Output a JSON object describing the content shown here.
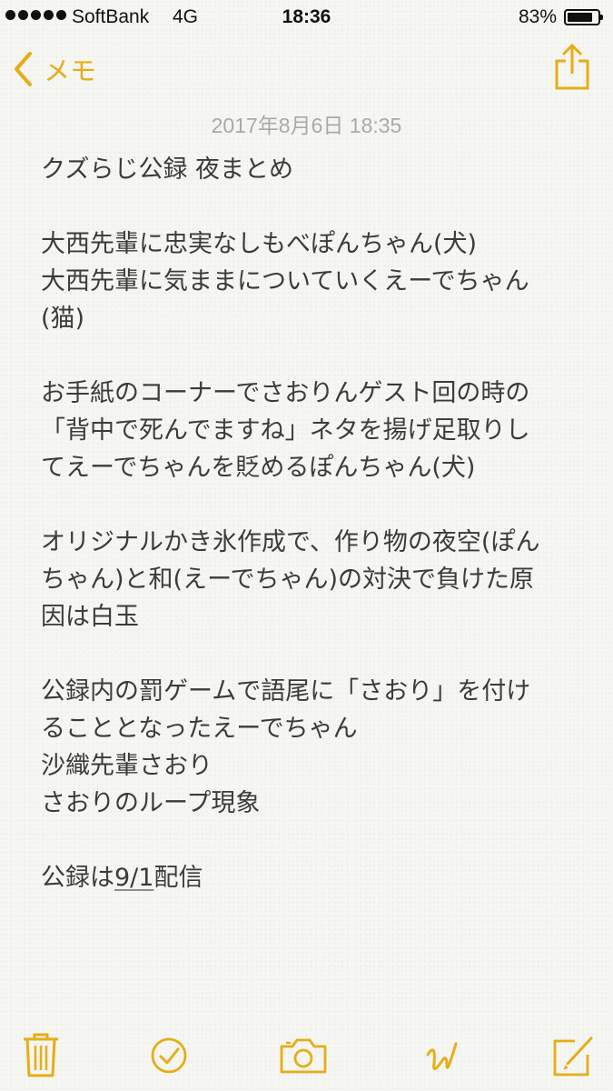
{
  "status_bar": {
    "carrier": "SoftBank",
    "network": "4G",
    "time": "18:36",
    "battery_percent_label": "83%",
    "battery_level": 0.83
  },
  "nav": {
    "back_label": "メモ",
    "accent_color": "#e6ad16"
  },
  "note": {
    "date": "2017年8月6日 18:35",
    "lines": [
      "クズらじ公録 夜まとめ",
      "",
      "大西先輩に忠実なしもべぽんちゃん(犬)",
      "大西先輩に気ままについていくえーでちゃん",
      "(猫)",
      "",
      "お手紙のコーナーでさおりんゲスト回の時の",
      "「背中で死んでますね」ネタを揚げ足取りし",
      "てえーでちゃんを貶めるぽんちゃん(犬)",
      "",
      "オリジナルかき氷作成で、作り物の夜空(ぽん",
      "ちゃん)と和(えーでちゃん)の対決で負けた原",
      "因は白玉",
      "",
      "公録内の罰ゲームで語尾に「さおり」を付け",
      "ることとなったえーでちゃん",
      "沙織先輩さおり",
      "さおりのループ現象"
    ],
    "last_line_prefix": "公録は",
    "last_line_link": "9/1",
    "last_line_suffix": "配信"
  },
  "toolbar": {
    "icons": [
      "trash-icon",
      "checklist-icon",
      "camera-icon",
      "sketch-icon",
      "compose-icon"
    ]
  }
}
